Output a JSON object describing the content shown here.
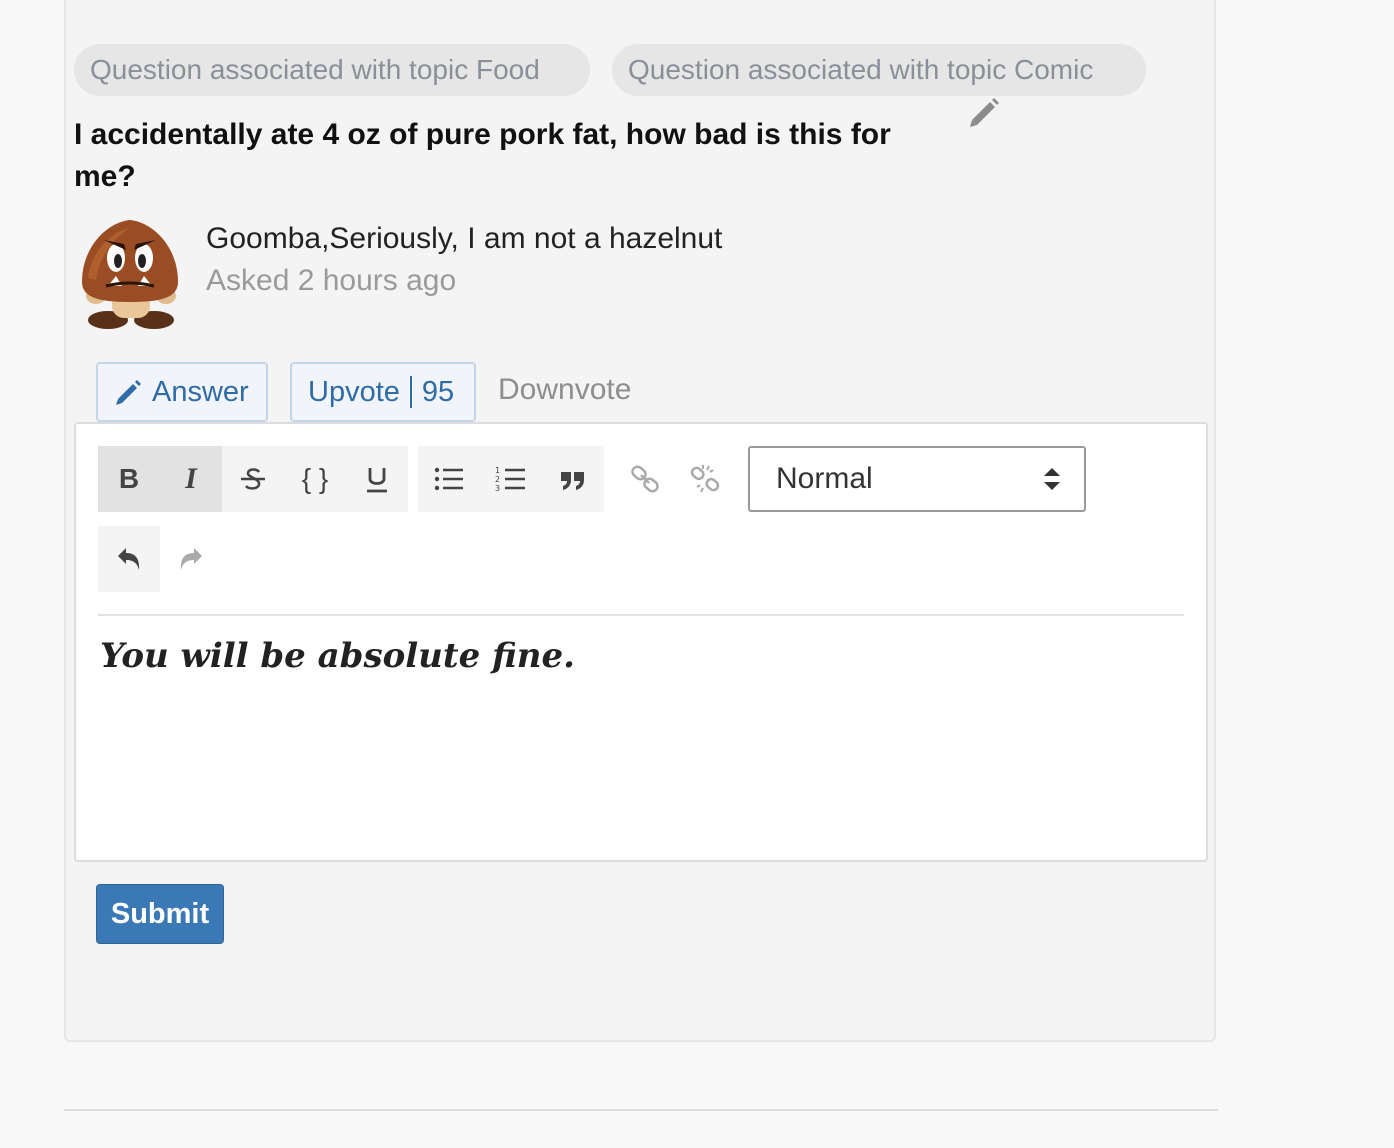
{
  "topics": [
    {
      "label": "Question associated with topic Food"
    },
    {
      "label": "Question associated with topic Comic"
    }
  ],
  "question": {
    "title": "I accidentally ate 4 oz of pure pork fat, how bad is this for me?",
    "author": "Goomba,Seriously, I am not a hazelnut",
    "asked": "Asked 2 hours ago"
  },
  "actions": {
    "answer_label": "Answer",
    "upvote_label": "Upvote",
    "upvote_count": "95",
    "downvote_label": "Downvote"
  },
  "editor": {
    "toolbar": {
      "bold": "B",
      "italic": "I",
      "code": "{ }",
      "format_selected": "Normal"
    },
    "content": "You will be absolute fine."
  },
  "submit_label": "Submit",
  "colors": {
    "primary": "#3b78b6",
    "link_blue": "#2f6ca6",
    "muted_text": "#9a9a9a"
  }
}
